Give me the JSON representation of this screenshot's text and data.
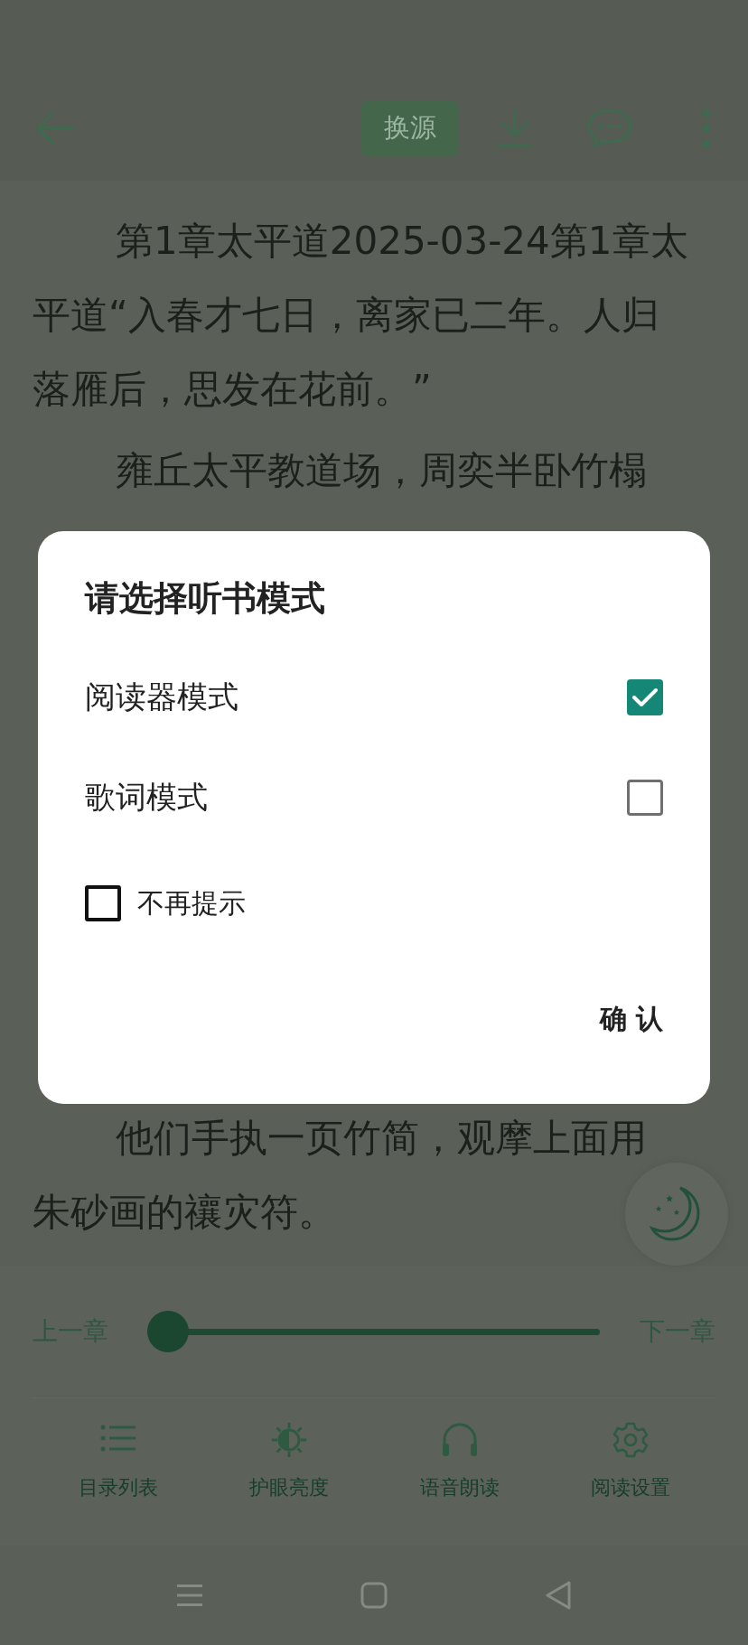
{
  "toolbar": {
    "source_button": "换源"
  },
  "chapter": {
    "paragraphs": [
      {
        "lines": [
          "第1章太平道2025-03-24第1章太",
          "平道“入春才七日，离家已二年。人归",
          "落雁后，思发在花前。”"
        ]
      },
      {
        "lines": [
          "雍丘太平教道场，周奕半卧竹榻"
        ]
      },
      {
        "lines": [
          "他们手执一页竹简，观摩上面用",
          "朱砂画的禳灾符。"
        ]
      }
    ]
  },
  "dialog": {
    "title": "请选择听书模式",
    "options": [
      {
        "label": "阅读器模式",
        "checked": true
      },
      {
        "label": "歌词模式",
        "checked": false
      }
    ],
    "dont_remind": {
      "label": "不再提示",
      "checked": false
    },
    "confirm": "确 认"
  },
  "chapter_nav": {
    "prev": "上一章",
    "next": "下一章",
    "progress": {
      "level": 0
    }
  },
  "bottom_tabs": [
    {
      "label": "目录列表"
    },
    {
      "label": "护眼亮度"
    },
    {
      "label": "语音朗读"
    },
    {
      "label": "阅读设置"
    }
  ]
}
